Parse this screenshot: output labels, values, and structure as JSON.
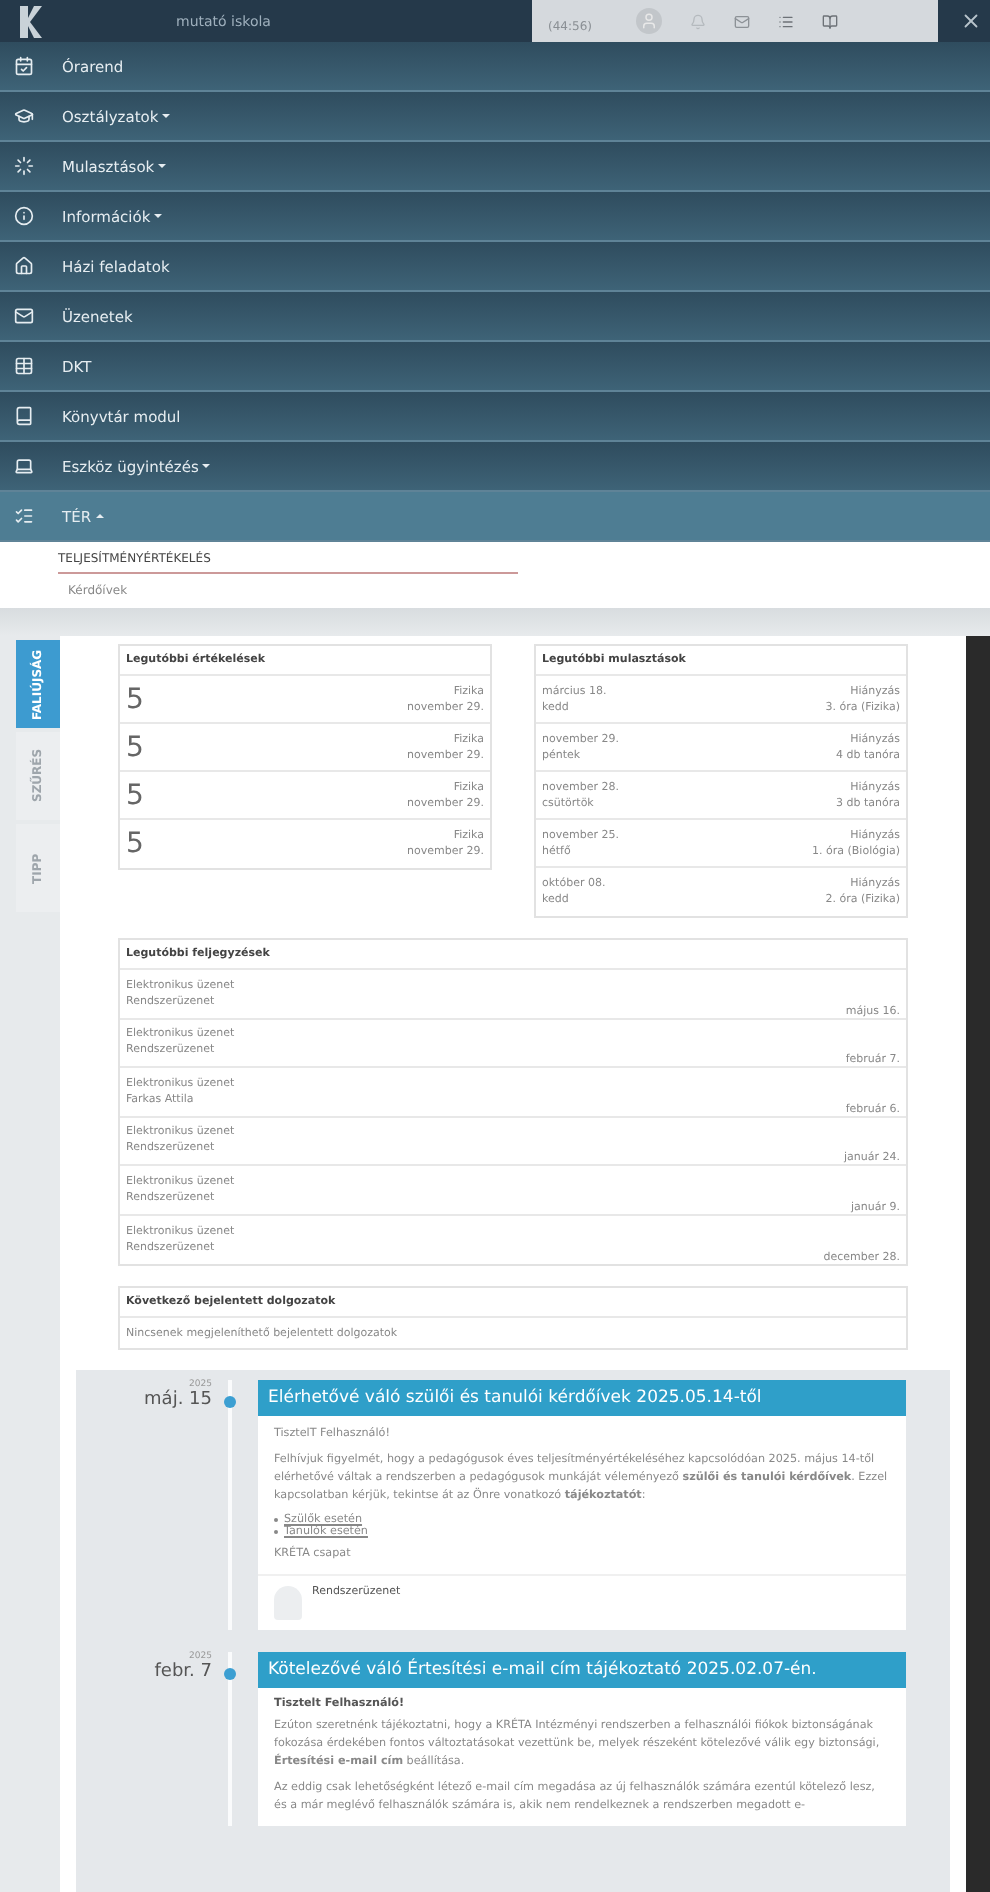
{
  "header": {
    "school": "mutató iskola",
    "timer": "(44:56)"
  },
  "menu": [
    {
      "label": "Órarend"
    },
    {
      "label": "Osztályzatok",
      "expanded": false
    },
    {
      "label": "Mulasztások",
      "expanded": false
    },
    {
      "label": "Információk",
      "expanded": false
    },
    {
      "label": "Házi feladatok"
    },
    {
      "label": "Üzenetek"
    },
    {
      "label": "DKT"
    },
    {
      "label": "Könyvtár modul"
    },
    {
      "label": "Eszköz ügyintézés",
      "expanded": false
    },
    {
      "label": "TÉR",
      "expanded": true
    }
  ],
  "submenu": {
    "heading": "TELJESÍTMÉNYÉRTÉKELÉS",
    "items": [
      "Kérdőívek"
    ]
  },
  "side_tabs": [
    {
      "label": "FALIÚJSÁG",
      "selected": true
    },
    {
      "label": "SZŰRÉS",
      "selected": false
    },
    {
      "label": "TIPP",
      "selected": false
    }
  ],
  "grades": {
    "title": "Legutóbbi értékelések",
    "rows": [
      {
        "grade": "5",
        "subject": "Fizika",
        "date": "november 29."
      },
      {
        "grade": "5",
        "subject": "Fizika",
        "date": "november 29."
      },
      {
        "grade": "5",
        "subject": "Fizika",
        "date": "november 29."
      },
      {
        "grade": "5",
        "subject": "Fizika",
        "date": "november 29."
      }
    ]
  },
  "absences": {
    "title": "Legutóbbi mulasztások",
    "rows": [
      {
        "date": "március 18.",
        "weekday": "kedd",
        "type": "Hiányzás",
        "detail": "3. óra (Fizika)"
      },
      {
        "date": "november 29.",
        "weekday": "péntek",
        "type": "Hiányzás",
        "detail": "4 db tanóra"
      },
      {
        "date": "november 28.",
        "weekday": "csütörtök",
        "type": "Hiányzás",
        "detail": "3 db tanóra"
      },
      {
        "date": "november 25.",
        "weekday": "hétfő",
        "type": "Hiányzás",
        "detail": "1. óra (Biológia)"
      },
      {
        "date": "október 08.",
        "weekday": "kedd",
        "type": "Hiányzás",
        "detail": "2. óra (Fizika)"
      }
    ]
  },
  "notes": {
    "title": "Legutóbbi feljegyzések",
    "rows": [
      {
        "type": "Elektronikus üzenet",
        "sender": "Rendszerüzenet",
        "date": "május 16."
      },
      {
        "type": "Elektronikus üzenet",
        "sender": "Rendszerüzenet",
        "date": "február 7."
      },
      {
        "type": "Elektronikus üzenet",
        "sender": "Farkas Attila",
        "date": "február 6."
      },
      {
        "type": "Elektronikus üzenet",
        "sender": "Rendszerüzenet",
        "date": "január 24."
      },
      {
        "type": "Elektronikus üzenet",
        "sender": "Rendszerüzenet",
        "date": "január 9."
      },
      {
        "type": "Elektronikus üzenet",
        "sender": "Rendszerüzenet",
        "date": "december 28."
      }
    ]
  },
  "tests": {
    "title": "Következő bejelentett dolgozatok",
    "empty": "Nincsenek megjeleníthető bejelentett dolgozatok"
  },
  "timeline": [
    {
      "year": "2025",
      "date": "máj. 15",
      "title": "Elérhetővé váló szülői és tanulói kérdőívek 2025.05.14-től",
      "author": "Rendszerüzenet",
      "blocks": [
        {
          "kind": "text",
          "text": "TisztelT Felhasználó!"
        },
        {
          "kind": "text",
          "text": "Felhívjuk figyelmét, hogy a pedagógusok éves teljesítményértékeléséhez kapcsolódóan 2025. május 14-től elérhetővé váltak a rendszerben a pedagógusok munkáját véleményező **szülői és tanulói kérdőívek**. Ezzel kapcsolatban kérjük, tekintse át az Önre vonatkozó **tájékoztatót**:"
        },
        {
          "kind": "links",
          "items": [
            "Szülők esetén",
            "Tanulók esetén"
          ]
        },
        {
          "kind": "text",
          "text": "KRÉTA csapat"
        }
      ]
    },
    {
      "year": "2025",
      "date": "febr. 7",
      "title": "Kötelezővé váló Értesítési e-mail cím tájékoztató 2025.02.07-én.",
      "blocks": [
        {
          "kind": "heading",
          "text": "Tisztelt Felhasználó!"
        },
        {
          "kind": "text",
          "text": "Ezúton szeretnénk tájékoztatni, hogy a KRÉTA Intézményi rendszerben a felhasználói fiókok biztonságának fokozása érdekében fontos változtatásokat vezettünk be, melyek részeként kötelezővé válik egy biztonsági, **Értesítési e-mail cím** beállítása."
        },
        {
          "kind": "text",
          "text": "Az eddig csak lehetőségként létező e-mail cím megadása az új felhasználók számára ezentúl kötelező lesz, és a már meglévő felhasználók számára is, akik nem rendelkeznek a rendszerben megadott e-"
        }
      ]
    }
  ]
}
